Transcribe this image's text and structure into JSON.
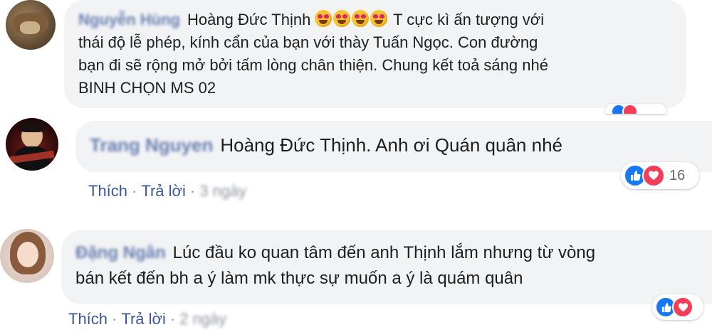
{
  "comments": [
    {
      "author": "Nguyễn Hùng",
      "text_prefix": "Hoàng Đức Thịnh",
      "emoji": "heart-eyes-emoji",
      "emoji_count": 4,
      "line1_rest": "T cực kì ấn tượng với",
      "line2": "thái độ lễ phép, kính cẩn của bạn với thày Tuấn Ngọc. Con đường",
      "line3": "bạn đi sẽ rộng mở bởi tấm lòng chân thiện. Chung kết toả sáng nhé",
      "line4": "BINH CHỌN MS 02"
    },
    {
      "author": "Trang Nguyen",
      "text": "Hoàng Đức Thịnh. Anh ơi Quán quân nhé",
      "reactions_count": "16",
      "like_label": "Thích",
      "reply_label": "Trả lời",
      "time": "3 ngày"
    },
    {
      "author": "Đặng Ngân",
      "line1": "Lúc đầu ko quan tâm đến anh Thịnh lắm nhưng từ vòng",
      "line2": "bán kết đến bh a ý làm mk thực sự muốn a ý là quám quân",
      "like_label": "Thích",
      "reply_label": "Trả lời",
      "time": "2 ngày"
    }
  ],
  "colors": {
    "bubble": "#f2f3f5",
    "link": "#385898",
    "like": "#1877f2",
    "love": "#f33e58"
  }
}
